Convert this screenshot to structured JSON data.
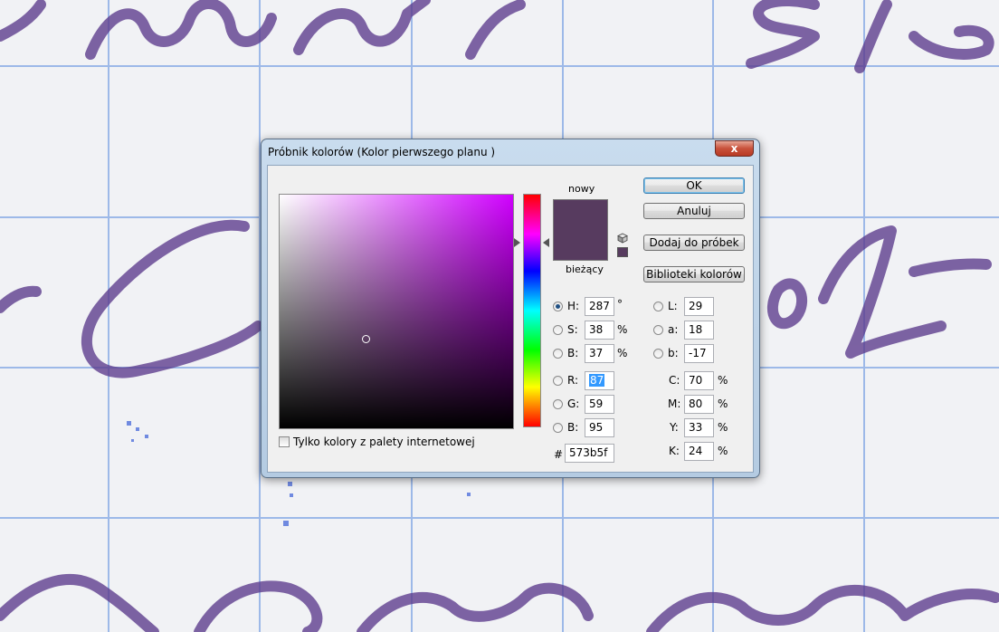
{
  "dialog": {
    "title": "Próbnik kolorów (Kolor pierwszego planu )",
    "close_label": "x"
  },
  "preview": {
    "new_label": "nowy",
    "current_label": "bieżący",
    "new_color": "#573b5f",
    "current_color": "#573b5f"
  },
  "buttons": {
    "ok": "OK",
    "cancel": "Anuluj",
    "add_to_swatches": "Dodaj do próbek",
    "color_libraries": "Biblioteki kolorów"
  },
  "hsb": {
    "h": {
      "label": "H:",
      "value": "287",
      "unit": "°",
      "selected": true
    },
    "s": {
      "label": "S:",
      "value": "38",
      "unit": "%"
    },
    "b": {
      "label": "B:",
      "value": "37",
      "unit": "%"
    }
  },
  "rgb": {
    "r": {
      "label": "R:",
      "value": "87"
    },
    "g": {
      "label": "G:",
      "value": "59"
    },
    "b": {
      "label": "B:",
      "value": "95"
    }
  },
  "lab": {
    "l": {
      "label": "L:",
      "value": "29"
    },
    "a": {
      "label": "a:",
      "value": "18"
    },
    "b": {
      "label": "b:",
      "value": "-17"
    }
  },
  "cmyk": {
    "c": {
      "label": "C:",
      "value": "70",
      "unit": "%"
    },
    "m": {
      "label": "M:",
      "value": "80",
      "unit": "%"
    },
    "y": {
      "label": "Y:",
      "value": "33",
      "unit": "%"
    },
    "k": {
      "label": "K:",
      "value": "24",
      "unit": "%"
    }
  },
  "hex": {
    "label": "#",
    "value": "573b5f"
  },
  "web_only": {
    "label": "Tylko kolory z palety internetowej",
    "checked": false
  },
  "colors": {
    "field_hue": "#d000ff",
    "ink": "#5b3a8c",
    "grid": "#8fb0e6"
  }
}
